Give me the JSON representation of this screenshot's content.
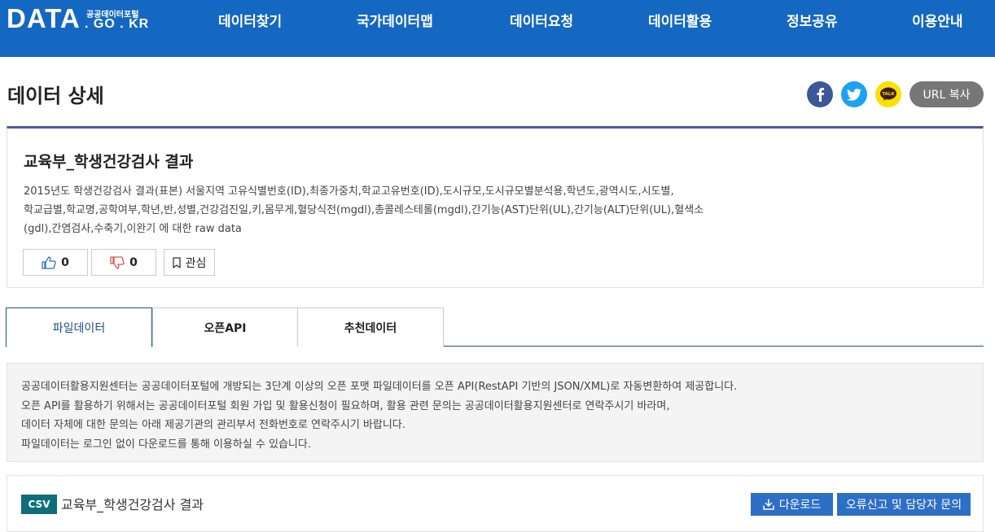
{
  "header": {
    "logo_main": "DATA",
    "logo_small": "공공데이터포털",
    "logo_domain": ". GO . KR",
    "nav": [
      "데이터찾기",
      "국가데이터맵",
      "데이터요청",
      "데이터활용",
      "정보공유",
      "이용안내"
    ]
  },
  "page": {
    "title": "데이터 상세",
    "url_copy": "URL 복사",
    "kakao_label": "TALK"
  },
  "dataset": {
    "title": "교육부_학생건강검사 결과",
    "description": [
      "2015년도 학생건강검사 결과(표본) 서울지역 고유식별번호(ID),최종가중치,학교고유번호(ID),도시규모,도시규모별분석용,학년도,광역시도,시도별,",
      "학교급별,학교명,공학여부,학년,반,성별,건강검진일,키,몸무게,혈당식전(mgdl),총콜레스테롤(mgdl),간기능(AST)단위(UL),간기능(ALT)단위(UL),혈색소",
      "(gdl),간염검사,수축기,이완기 에 대한 raw data"
    ],
    "likes": "0",
    "dislikes": "0",
    "favorite_label": "관심"
  },
  "tabs": [
    "파일데이터",
    "오픈API",
    "추천데이터"
  ],
  "notice": [
    "공공데이터활용지원센터는 공공데이터포털에 개방되는 3단계 이상의 오픈 포맷 파일데이터를 오픈 API(RestAPI 기반의 JSON/XML)로 자동변환하여 제공합니다.",
    "오픈 API를 활용하기 위해서는 공공데이터포털 회원 가입 및 활용신청이 필요하며, 활용 관련 문의는 공공데이터활용지원센터로 연락주시기 바라며,",
    "데이터 자체에 대한 문의는 아래 제공기관의 관리부서 전화번호로 연락주시기 바랍니다.",
    "파일데이터는 로그인 없이 다운로드를 통해 이용하실 수 있습니다."
  ],
  "file": {
    "format": "CSV",
    "name": "교육부_학생건강검사 결과",
    "download_label": "다운로드",
    "report_label": "오류신고 및 담당자 문의"
  },
  "colors": {
    "header_bg": "#1468c2",
    "card_accent": "#4a5a9e",
    "tab_active": "#1a4f8b",
    "csv_badge": "#0f6e7a",
    "button_blue": "#2d6fc4"
  }
}
